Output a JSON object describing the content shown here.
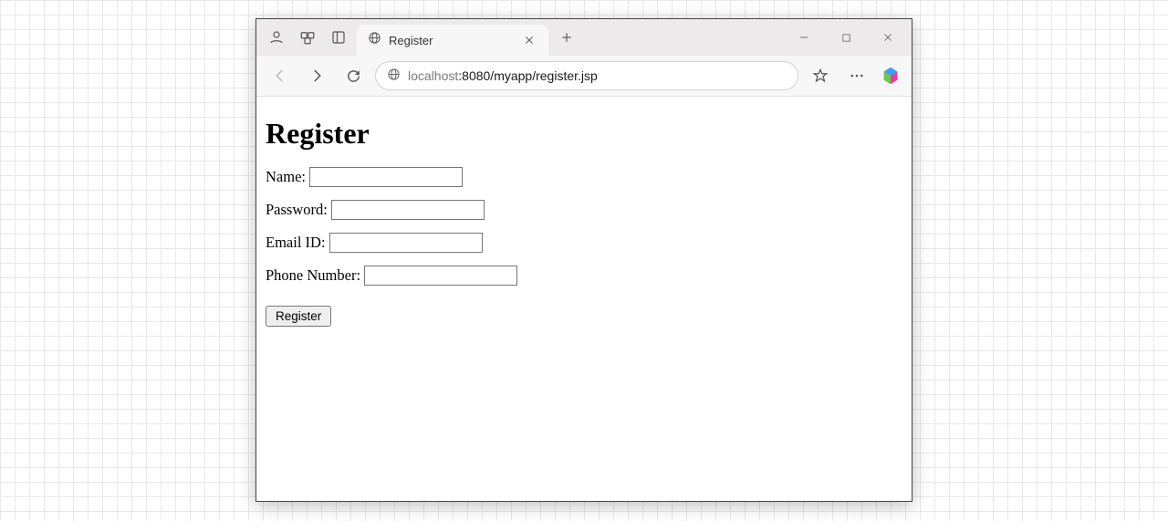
{
  "browser": {
    "tab_title": "Register",
    "url_host": "localhost",
    "url_port_path": ":8080/myapp/register.jsp"
  },
  "page": {
    "heading": "Register",
    "labels": {
      "name": "Name:",
      "password": "Password:",
      "email": "Email ID:",
      "phone": "Phone Number:"
    },
    "submit_label": "Register"
  }
}
